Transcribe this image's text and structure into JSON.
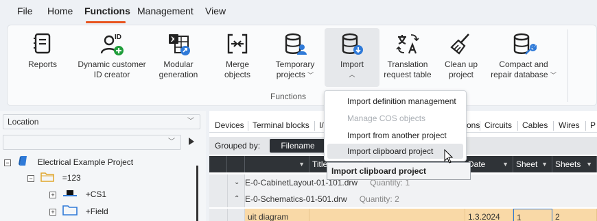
{
  "menubar": {
    "items": [
      "File",
      "Home",
      "Functions",
      "Management",
      "View"
    ],
    "active": "Functions",
    "accent_color": "#e8541e"
  },
  "ribbon": {
    "group_label": "Functions",
    "buttons": [
      {
        "label": "Reports",
        "icon": "notebook-icon"
      },
      {
        "label": "Dynamic customer ID creator",
        "icon": "user-id-add-icon"
      },
      {
        "label": "Modular generation",
        "icon": "excel-share-icon"
      },
      {
        "label": "Merge objects",
        "icon": "merge-icon"
      },
      {
        "label": "Temporary projects",
        "icon": "database-user-icon",
        "dropdown": true
      },
      {
        "label": "Import",
        "icon": "database-download-icon",
        "dropdown": true,
        "pressed": true
      },
      {
        "label": "Translation request table",
        "icon": "translate-icon"
      },
      {
        "label": "Clean up project",
        "icon": "broom-icon"
      },
      {
        "label": "Compact and repair database",
        "icon": "database-wrench-icon",
        "dropdown": true
      }
    ]
  },
  "left": {
    "location_combo": "Location",
    "second_combo": "",
    "tree": [
      {
        "label": "Electrical Example Project",
        "icon": "project-icon",
        "expander": "−"
      },
      {
        "label": "=123",
        "icon": "folder-icon",
        "expander": "−"
      },
      {
        "label": "+CS1",
        "icon": "cabinet-icon",
        "expander": "+"
      },
      {
        "label": "+Field",
        "icon": "folder-icon",
        "expander": "+"
      }
    ]
  },
  "right": {
    "tabs": [
      "Devices",
      "Terminal blocks",
      "I/",
      "ons",
      "Circuits",
      "Cables",
      "Wires",
      "P"
    ],
    "grouped_by_label": "Grouped by:",
    "group_chip": "Filename",
    "columns": [
      "Title",
      "Date",
      "Sheet",
      "Sheets"
    ],
    "groups": [
      {
        "name": "E-0-CabinetLayout-01-101.drw",
        "quantity": "Quantity: 1",
        "expanded": false
      },
      {
        "name": "E-0-Schematics-01-501.drw",
        "quantity": "Quantity: 2",
        "expanded": true
      }
    ],
    "data_row": {
      "title": "uit diagram",
      "date": "1.3.2024",
      "sheet": "1",
      "sheets": "2"
    }
  },
  "dropdown": {
    "items": [
      {
        "label": "Import definition management",
        "disabled": false
      },
      {
        "label": "Manage COS objects",
        "disabled": true
      },
      {
        "label": "Import from another project",
        "disabled": false
      },
      {
        "label": "Import clipboard project",
        "disabled": false,
        "hover": true
      }
    ],
    "tooltip": "Import clipboard project"
  }
}
